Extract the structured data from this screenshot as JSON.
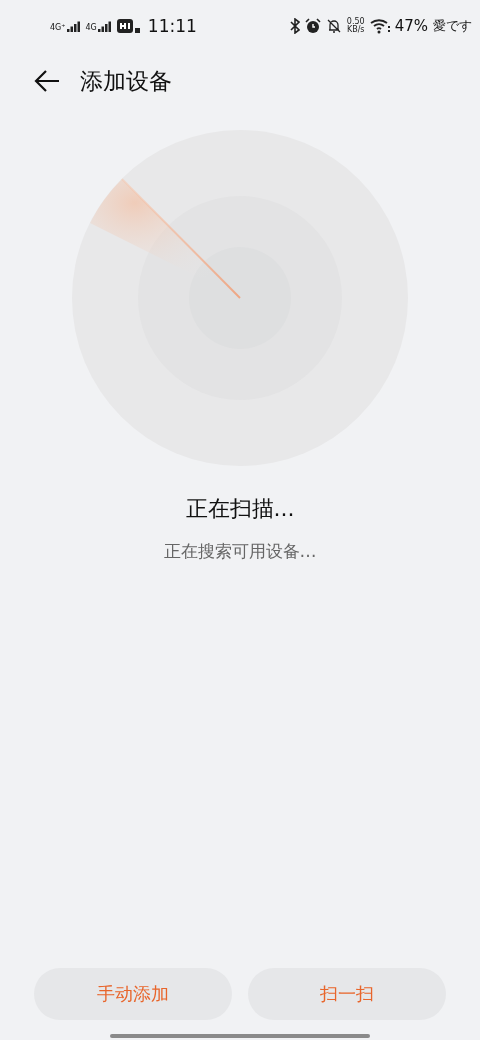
{
  "status_bar": {
    "time": "11:11",
    "network_1": "4G⁺",
    "network_2": "4G",
    "speed_value": "0.50",
    "speed_unit": "KB/s",
    "battery": "47%",
    "carrier_note": "愛です"
  },
  "header": {
    "title": "添加设备"
  },
  "scan": {
    "title": "正在扫描...",
    "subtitle": "正在搜索可用设备…"
  },
  "buttons": [
    {
      "label": "手动添加",
      "kind": "accent"
    },
    {
      "label": "扫一扫",
      "kind": "accent"
    }
  ]
}
